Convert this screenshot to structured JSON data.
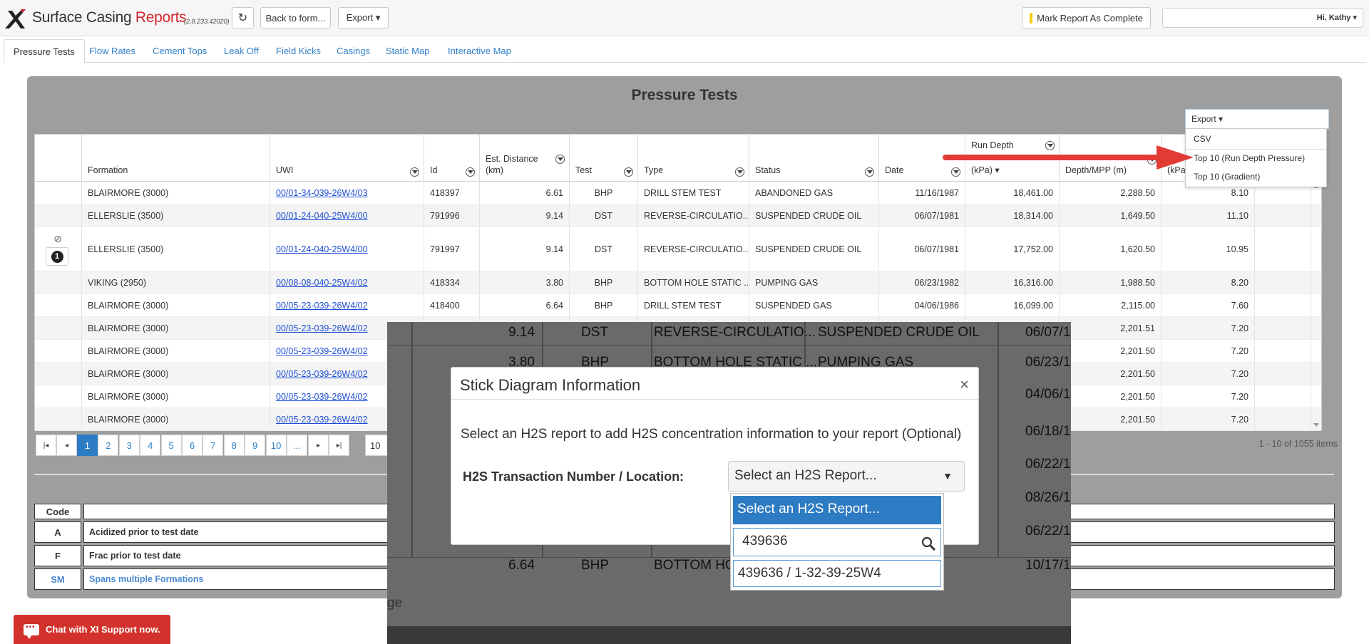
{
  "app": {
    "title_prefix": "Surface Casing ",
    "title_accent": "Reports",
    "version": "(2.8.233.42020)",
    "back_label": "Back to form...",
    "export_label": "Export ▾",
    "complete_label": "Mark Report As Complete",
    "user_label": "Hi, Kathy ▾",
    "refresh_icon": "↻"
  },
  "tabs": [
    "Pressure Tests",
    "Flow Rates",
    "Cement Tops",
    "Leak Off",
    "Field Kicks",
    "Casings",
    "Static Map",
    "Interactive Map"
  ],
  "panel": {
    "title": "Pressure Tests",
    "export_label": "Export ▾",
    "export_menu": [
      "CSV",
      "Top 10 (Run Depth Pressure)",
      "Top 10 (Gradient)"
    ]
  },
  "grid": {
    "headers": {
      "formation": "Formation",
      "uwi": "UWI",
      "id": "Id",
      "est_distance": "Est. Distance\n(km)",
      "test": "Test",
      "type": "Type",
      "status": "Status",
      "date": "Date",
      "run_depth_group": "Run Depth",
      "run_depth_sub": "(kPa) ▾",
      "depth": "Depth/MPP (m)",
      "grad": "(kPa/"
    },
    "rows": [
      {
        "formation": "BLAIRMORE (3000)",
        "uwi": "00/01-34-039-26W4/03",
        "id": "418397",
        "dist": "6.61",
        "test": "BHP",
        "type": "DRILL STEM TEST",
        "status": "ABANDONED GAS",
        "date": "11/16/1987",
        "pressure": "18,461.00",
        "depth": "2,288.50",
        "grad": "8.10"
      },
      {
        "formation": "ELLERSLIE (3500)",
        "uwi": "00/01-24-040-25W4/00",
        "id": "791996",
        "dist": "9.14",
        "test": "DST",
        "type": "REVERSE-CIRCULATIO...",
        "status": "SUSPENDED CRUDE OIL",
        "date": "06/07/1981",
        "pressure": "18,314.00",
        "depth": "1,649.50",
        "grad": "11.10"
      },
      {
        "formation": "ELLERSLIE (3500)",
        "uwi": "00/01-24-040-25W4/00",
        "id": "791997",
        "dist": "9.14",
        "test": "DST",
        "type": "REVERSE-CIRCULATIO...",
        "status": "SUSPENDED CRUDE OIL",
        "date": "06/07/1981",
        "pressure": "17,752.00",
        "depth": "1,620.50",
        "grad": "10.95",
        "badge": "1",
        "icon": "⊘"
      },
      {
        "formation": "VIKING (2950)",
        "uwi": "00/08-08-040-25W4/02",
        "id": "418334",
        "dist": "3.80",
        "test": "BHP",
        "type": "BOTTOM HOLE STATIC ...",
        "status": "PUMPING GAS",
        "date": "06/23/1982",
        "pressure": "16,316.00",
        "depth": "1,988.50",
        "grad": "8.20"
      },
      {
        "formation": "BLAIRMORE (3000)",
        "uwi": "00/05-23-039-26W4/02",
        "id": "418400",
        "dist": "6.64",
        "test": "BHP",
        "type": "DRILL STEM TEST",
        "status": "SUSPENDED GAS",
        "date": "04/06/1986",
        "pressure": "16,099.00",
        "depth": "2,115.00",
        "grad": "7.60"
      },
      {
        "formation": "BLAIRMORE (3000)",
        "uwi": "00/05-23-039-26W4/02",
        "id": "",
        "dist": "",
        "test": "",
        "type": "",
        "status": "",
        "date": "",
        "pressure": "",
        "depth": "2,201.51",
        "grad": "7.20"
      },
      {
        "formation": "BLAIRMORE (3000)",
        "uwi": "00/05-23-039-26W4/02",
        "id": "",
        "dist": "",
        "test": "",
        "type": "",
        "status": "",
        "date": "",
        "pressure": "",
        "depth": "2,201.50",
        "grad": "7.20"
      },
      {
        "formation": "BLAIRMORE (3000)",
        "uwi": "00/05-23-039-26W4/02",
        "id": "",
        "dist": "",
        "test": "",
        "type": "",
        "status": "",
        "date": "",
        "pressure": "",
        "depth": "2,201.50",
        "grad": "7.20"
      },
      {
        "formation": "BLAIRMORE (3000)",
        "uwi": "00/05-23-039-26W4/02",
        "id": "",
        "dist": "",
        "test": "",
        "type": "",
        "status": "",
        "date": "",
        "pressure": "",
        "depth": "2,201.50",
        "grad": "7.20"
      },
      {
        "formation": "BLAIRMORE (3000)",
        "uwi": "00/05-23-039-26W4/02",
        "id": "",
        "dist": "",
        "test": "",
        "type": "",
        "status": "",
        "date": "",
        "pressure": "",
        "depth": "2,201.50",
        "grad": "7.20"
      }
    ]
  },
  "pager": {
    "first": "|◂",
    "prev": "◂",
    "next": "▸",
    "last": "▸|",
    "pages": [
      "1",
      "2",
      "3",
      "4",
      "5",
      "6",
      "7",
      "8",
      "9",
      "10",
      "..."
    ],
    "active_page": "1",
    "page_size": "10",
    "info": "1 - 10 of 1055 items"
  },
  "legend": {
    "header_code": "Code",
    "rows": [
      {
        "code": "A",
        "desc": "Acidized prior to test date"
      },
      {
        "code": "F",
        "desc": "Frac prior to test date"
      },
      {
        "code": "SM",
        "desc": "Spans multiple Formations"
      }
    ]
  },
  "background_zoom": {
    "rows": [
      {
        "dist": "9.14",
        "test": "DST",
        "type": "REVERSE-CIRCULATIO...",
        "status": "SUSPENDED CRUDE OIL",
        "date": "06/07/1"
      },
      {
        "dist": "3.80",
        "test": "BHP",
        "type": "BOTTOM HOLE STATIC ...",
        "status": "PUMPING GAS",
        "date": "06/23/1"
      },
      {
        "date": "04/06/1"
      },
      {
        "date": "06/18/1"
      },
      {
        "date": "06/22/1"
      },
      {
        "date": "08/26/1"
      },
      {
        "date": "06/22/1"
      },
      {
        "dist": "6.64",
        "test": "BHP",
        "type": "BOTTOM HO",
        "date": "10/17/1"
      }
    ],
    "footer_fragment": "ge"
  },
  "modal": {
    "title": "Stick Diagram Information",
    "close": "×",
    "description": "Select an H2S report to add H2S concentration information to your report (Optional)",
    "field_label": "H2S Transaction Number / Location:",
    "select_value": "Select an H2S Report...",
    "select_caret": "▼",
    "dropdown": {
      "selected": "Select an H2S Report...",
      "search_value": "439636",
      "option": "439636 / 1-32-39-25W4"
    }
  },
  "chat": {
    "label": "Chat with XI Support now."
  }
}
